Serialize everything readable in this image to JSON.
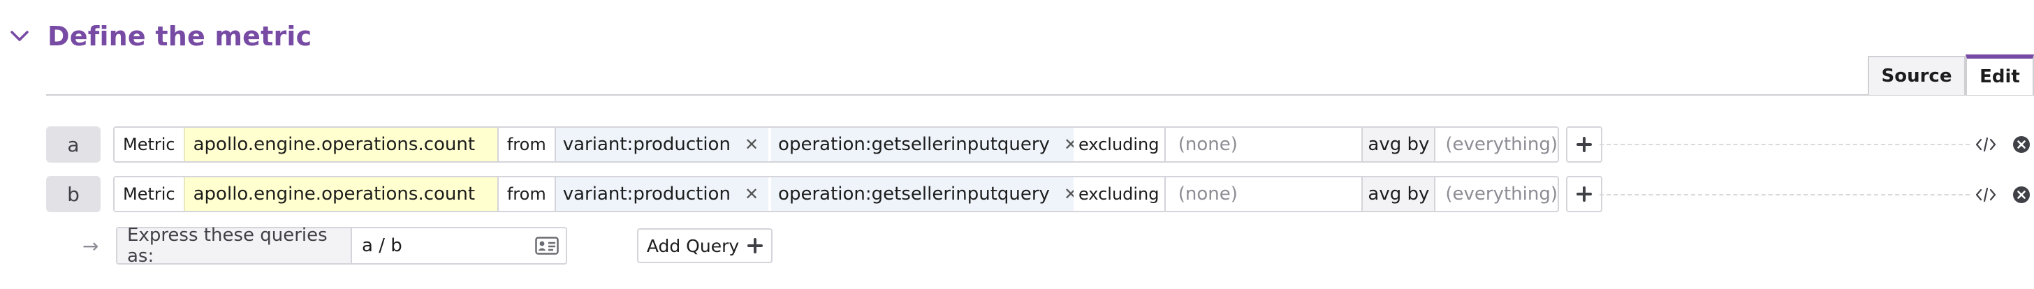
{
  "section": {
    "title": "Define the metric"
  },
  "tabs": [
    {
      "label": "Source",
      "active": false
    },
    {
      "label": "Edit",
      "active": true
    }
  ],
  "queries": [
    {
      "letter": "a",
      "metric_label": "Metric",
      "metric_name": "apollo.engine.operations.count",
      "from_label": "from",
      "tags": [
        "variant:production",
        "operation:getsellerinputquery"
      ],
      "excluding_label": "excluding",
      "excluding_value": "(none)",
      "agg_label": "avg by",
      "agg_value": "(everything)"
    },
    {
      "letter": "b",
      "metric_label": "Metric",
      "metric_name": "apollo.engine.operations.count",
      "from_label": "from",
      "tags": [
        "variant:production",
        "operation:getsellerinputquery"
      ],
      "excluding_label": "excluding",
      "excluding_value": "(none)",
      "agg_label": "avg by",
      "agg_value": "(everything)"
    }
  ],
  "formula": {
    "label": "Express these queries as:",
    "value": "a / b"
  },
  "add_query_label": "Add Query",
  "colors": {
    "accent": "#774aa4",
    "metric_bg": "#ffffcf",
    "tag_bg": "#eef4fa"
  }
}
